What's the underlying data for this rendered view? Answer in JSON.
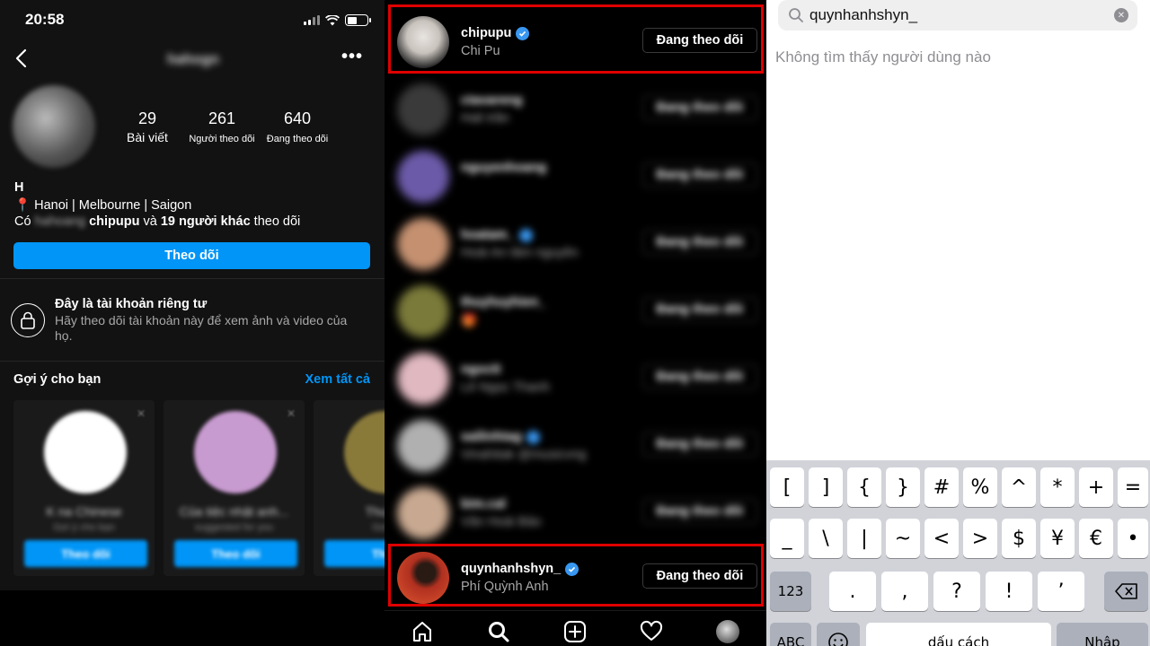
{
  "panel1": {
    "status_time": "20:58",
    "profile_username": "hahogn",
    "stats": [
      {
        "value": "29",
        "label": "Bài viết"
      },
      {
        "value": "261",
        "label": "Người theo dõi"
      },
      {
        "value": "640",
        "label": "Đang theo dõi"
      }
    ],
    "display_name": "H",
    "location_pin": "📍",
    "location": "Hanoi | Melbourne | Saigon",
    "followed_by_prefix": "Có",
    "followed_by_blurred": "hahoang",
    "followed_by_user": "chipupu",
    "followed_by_mid": "và",
    "followed_by_count": "19 người khác",
    "followed_by_suffix": "theo dõi",
    "follow_button": "Theo dõi",
    "private_title": "Đây là tài khoản riêng tư",
    "private_desc": "Hãy theo dõi tài khoản này để xem ảnh và video của họ.",
    "suggest_title": "Gợi ý cho bạn",
    "see_all": "Xem tất cả",
    "cards": [
      {
        "name": "K na Chinese",
        "sub": "Gợi ý cho bạn",
        "button": "Theo dõi",
        "color": "#ffffff"
      },
      {
        "name": "Của tiệc nhật anh...",
        "sub": "suggested for you",
        "button": "Theo dõi",
        "color": "#c89bd0"
      },
      {
        "name": "Thuy...",
        "sub": "Gợi ý",
        "button": "Theo",
        "color": "#8a7a3a"
      }
    ]
  },
  "panel2": {
    "rows": [
      {
        "username": "chipupu",
        "fullname": "Chi Pu",
        "verified": true,
        "button": "Đang theo dõi",
        "blurred": false,
        "avatar": "#c9c3bd"
      },
      {
        "username": "ctavareng",
        "fullname": "Hali trần",
        "verified": false,
        "button": "Đang theo dõi",
        "blurred": true,
        "avatar": "#3a3a3a"
      },
      {
        "username": "nguyenhoang",
        "fullname": "",
        "verified": false,
        "button": "Đang theo dõi",
        "blurred": true,
        "avatar": "#6b5aa8"
      },
      {
        "username": "hoatam_",
        "fullname": "Hoài An tâm nguyên",
        "verified": true,
        "button": "Đang theo dõi",
        "blurred": true,
        "avatar": "#c49070"
      },
      {
        "username": "thuyhuyhien_",
        "fullname": "🎁",
        "verified": false,
        "button": "Đang theo dõi",
        "blurred": true,
        "avatar": "#7a7a3a"
      },
      {
        "username": "ngoctt",
        "fullname": "Lê Ngọc Thanh",
        "verified": false,
        "button": "Đang theo dõi",
        "blurred": true,
        "avatar": "#e0b8c0"
      },
      {
        "username": "sailinhtag",
        "fullname": "Vinahitak @musicvng",
        "verified": true,
        "button": "Đang theo dõi",
        "blurred": true,
        "avatar": "#b0b0b0"
      },
      {
        "username": "bim.cal",
        "fullname": "Văn Hoài Bảo",
        "verified": false,
        "button": "Đang theo dõi",
        "blurred": true,
        "avatar": "#c8a890"
      },
      {
        "username": "quynhanhshyn_",
        "fullname": "Phí Quỳnh Anh",
        "verified": true,
        "button": "Đang theo dõi",
        "blurred": false,
        "avatar": "#b03020"
      }
    ],
    "tabs": [
      "home-icon",
      "search-icon",
      "add-post-icon",
      "heart-icon",
      "profile-avatar"
    ]
  },
  "panel3": {
    "search_value": "quynhanhshyn_",
    "no_user_text": "Không tìm thấy người dùng nào",
    "keyboard": {
      "row1": [
        "[",
        "]",
        "{",
        "}",
        "#",
        "%",
        "^",
        "*",
        "+",
        "="
      ],
      "row2": [
        "_",
        "\\",
        "|",
        "~",
        "<",
        ">",
        "$",
        "¥",
        "€",
        "•"
      ],
      "row3_left": "123",
      "row3": [
        ".",
        ",",
        "?",
        "!",
        "’"
      ],
      "row4_left": "ABC",
      "space": "dấu cách",
      "enter": "Nhập"
    }
  },
  "colors": {
    "accent": "#0095f6",
    "verified": "#3897f0",
    "highlight": "#e00000"
  }
}
